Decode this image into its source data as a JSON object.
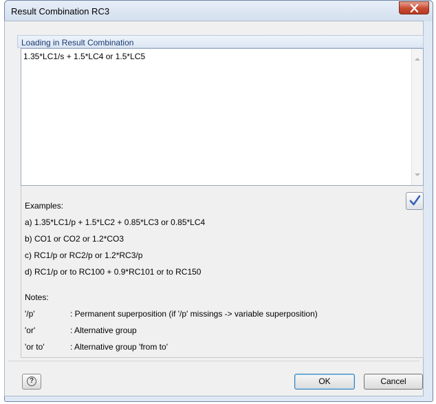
{
  "window": {
    "title": "Result Combination RC3"
  },
  "section": {
    "header": "Loading in Result Combination"
  },
  "input": {
    "value": "1.35*LC1/s + 1.5*LC4 or 1.5*LC5"
  },
  "examples": {
    "heading": "Examples:",
    "items": [
      "a) 1.35*LC1/p + 1.5*LC2 + 0.85*LC3 or 0.85*LC4",
      "b) CO1 or CO2 or 1.2*CO3",
      "c) RC1/p or RC2/p or 1.2*RC3/p",
      "d) RC1/p or to RC100 + 0.9*RC101 or to RC150"
    ]
  },
  "notes": {
    "heading": "Notes:",
    "items": [
      {
        "key": "'/p'",
        "desc": ": Permanent superposition (if '/p' missings -> variable superposition)"
      },
      {
        "key": "'or'",
        "desc": ": Alternative group"
      },
      {
        "key": "'or to'",
        "desc": ": Alternative group 'from to'"
      }
    ]
  },
  "buttons": {
    "ok": "OK",
    "cancel": "Cancel",
    "help_glyph": "?"
  },
  "icons": {
    "close": "close-icon",
    "check": "check-icon",
    "help": "help-icon"
  },
  "colors": {
    "close_button": "#c74a30",
    "header_text": "#1c3a73",
    "check_mark": "#3a62b8"
  }
}
